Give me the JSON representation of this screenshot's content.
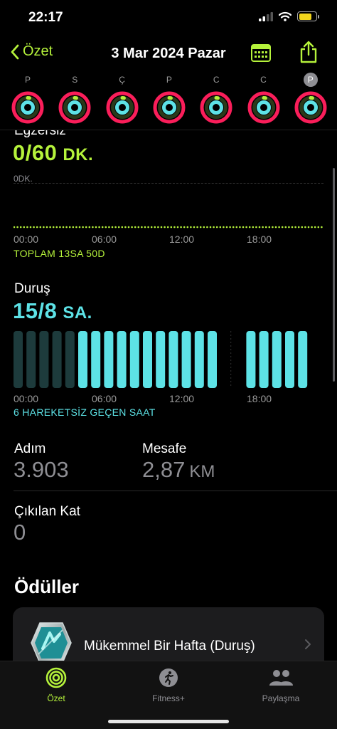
{
  "status": {
    "time": "22:17"
  },
  "nav": {
    "back_label": "Özet",
    "title": "3 Mar 2024 Pazar"
  },
  "week": {
    "days": [
      {
        "letter": "P",
        "selected": false
      },
      {
        "letter": "S",
        "selected": false
      },
      {
        "letter": "Ç",
        "selected": false
      },
      {
        "letter": "P",
        "selected": false
      },
      {
        "letter": "C",
        "selected": false
      },
      {
        "letter": "C",
        "selected": false
      },
      {
        "letter": "P",
        "selected": true
      }
    ]
  },
  "exercise": {
    "label": "Egzersiz",
    "value": "0/60",
    "unit": "DK.",
    "zero_label": "0DK.",
    "axis": [
      "00:00",
      "06:00",
      "12:00",
      "18:00"
    ],
    "total": "TOPLAM 13SA 50D"
  },
  "stand": {
    "label": "Duruş",
    "value": "15/8",
    "unit": "SA.",
    "axis": [
      "00:00",
      "06:00",
      "12:00",
      "18:00"
    ],
    "note": "6 HAREKETSİZ GEÇEN SAAT",
    "hours_active": [
      false,
      false,
      false,
      false,
      false,
      true,
      true,
      true,
      true,
      true,
      true,
      true,
      true,
      true,
      true,
      true,
      null,
      true,
      true,
      true,
      true,
      true
    ]
  },
  "stats": {
    "steps_label": "Adım",
    "steps_value": "3.903",
    "distance_label": "Mesafe",
    "distance_value": "2,87",
    "distance_unit": "KM",
    "floors_label": "Çıkılan Kat",
    "floors_value": "0"
  },
  "awards": {
    "title": "Ödüller",
    "item_name": "Mükemmel Bir Hafta (Duruş)"
  },
  "tabs": [
    {
      "label": "Özet",
      "active": true
    },
    {
      "label": "Fitness+",
      "active": false
    },
    {
      "label": "Paylaşma",
      "active": false
    }
  ],
  "colors": {
    "exercise": "#b5f23b",
    "stand": "#5de2e6",
    "move": "#fa1e5a",
    "active_tab": "#b5f23b"
  }
}
